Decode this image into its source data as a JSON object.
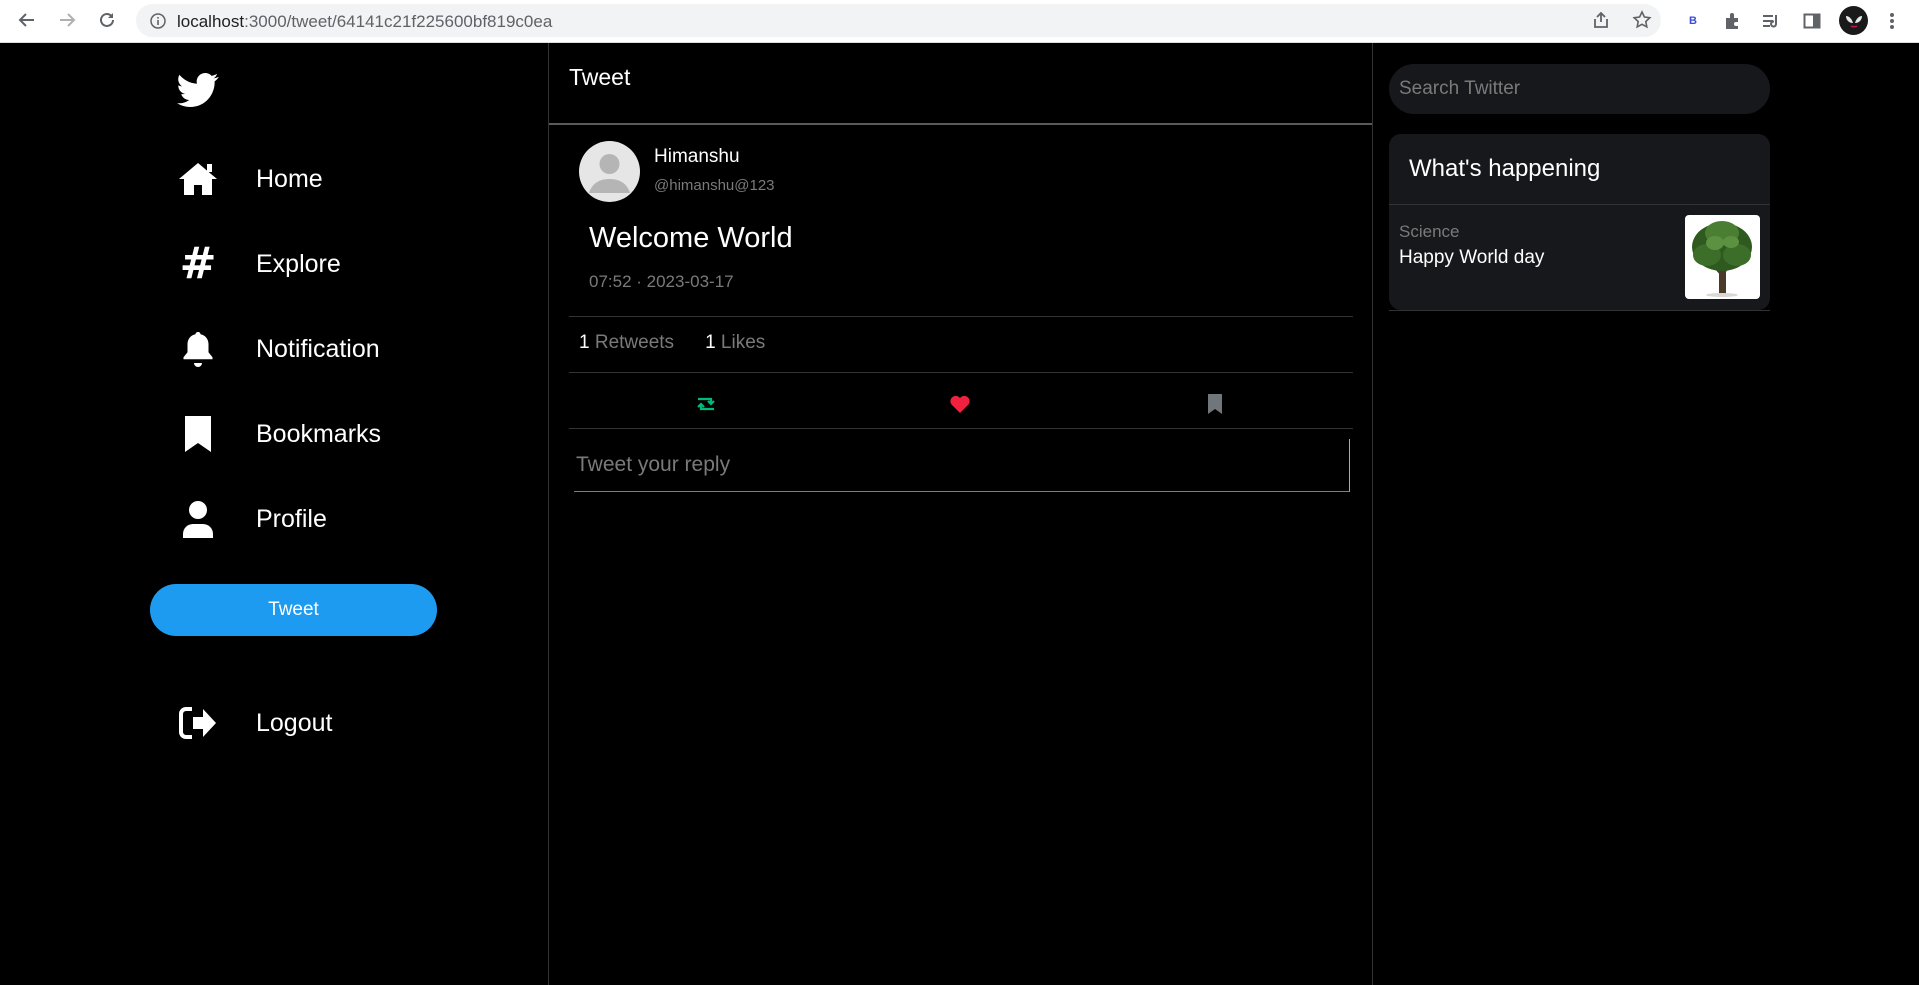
{
  "browser": {
    "url_host": "localhost",
    "url_path": ":3000/tweet/64141c21f225600bf819c0ea",
    "extension_badge": "B"
  },
  "sidebar": {
    "items": [
      {
        "label": "Home",
        "icon": "home-icon"
      },
      {
        "label": "Explore",
        "icon": "hashtag-icon"
      },
      {
        "label": "Notification",
        "icon": "bell-icon"
      },
      {
        "label": "Bookmarks",
        "icon": "bookmark-icon"
      },
      {
        "label": "Profile",
        "icon": "user-icon"
      }
    ],
    "tweet_button": "Tweet",
    "logout": "Logout"
  },
  "main": {
    "title": "Tweet",
    "tweet": {
      "author_name": "Himanshu",
      "author_handle": "@himanshu@123",
      "text": "Welcome World",
      "timestamp": "07:52 · 2023-03-17",
      "retweets_count": "1",
      "retweets_label": "Retweets",
      "likes_count": "1",
      "likes_label": "Likes"
    },
    "reply_placeholder": "Tweet your reply"
  },
  "right": {
    "search_placeholder": "Search Twitter",
    "trends_title": "What's happening",
    "trend": {
      "category": "Science",
      "topic": "Happy World day"
    }
  },
  "colors": {
    "accent": "#1d9bf0",
    "retweet": "#00ba7c",
    "like": "#f91880",
    "bookmark": "#71767b"
  }
}
